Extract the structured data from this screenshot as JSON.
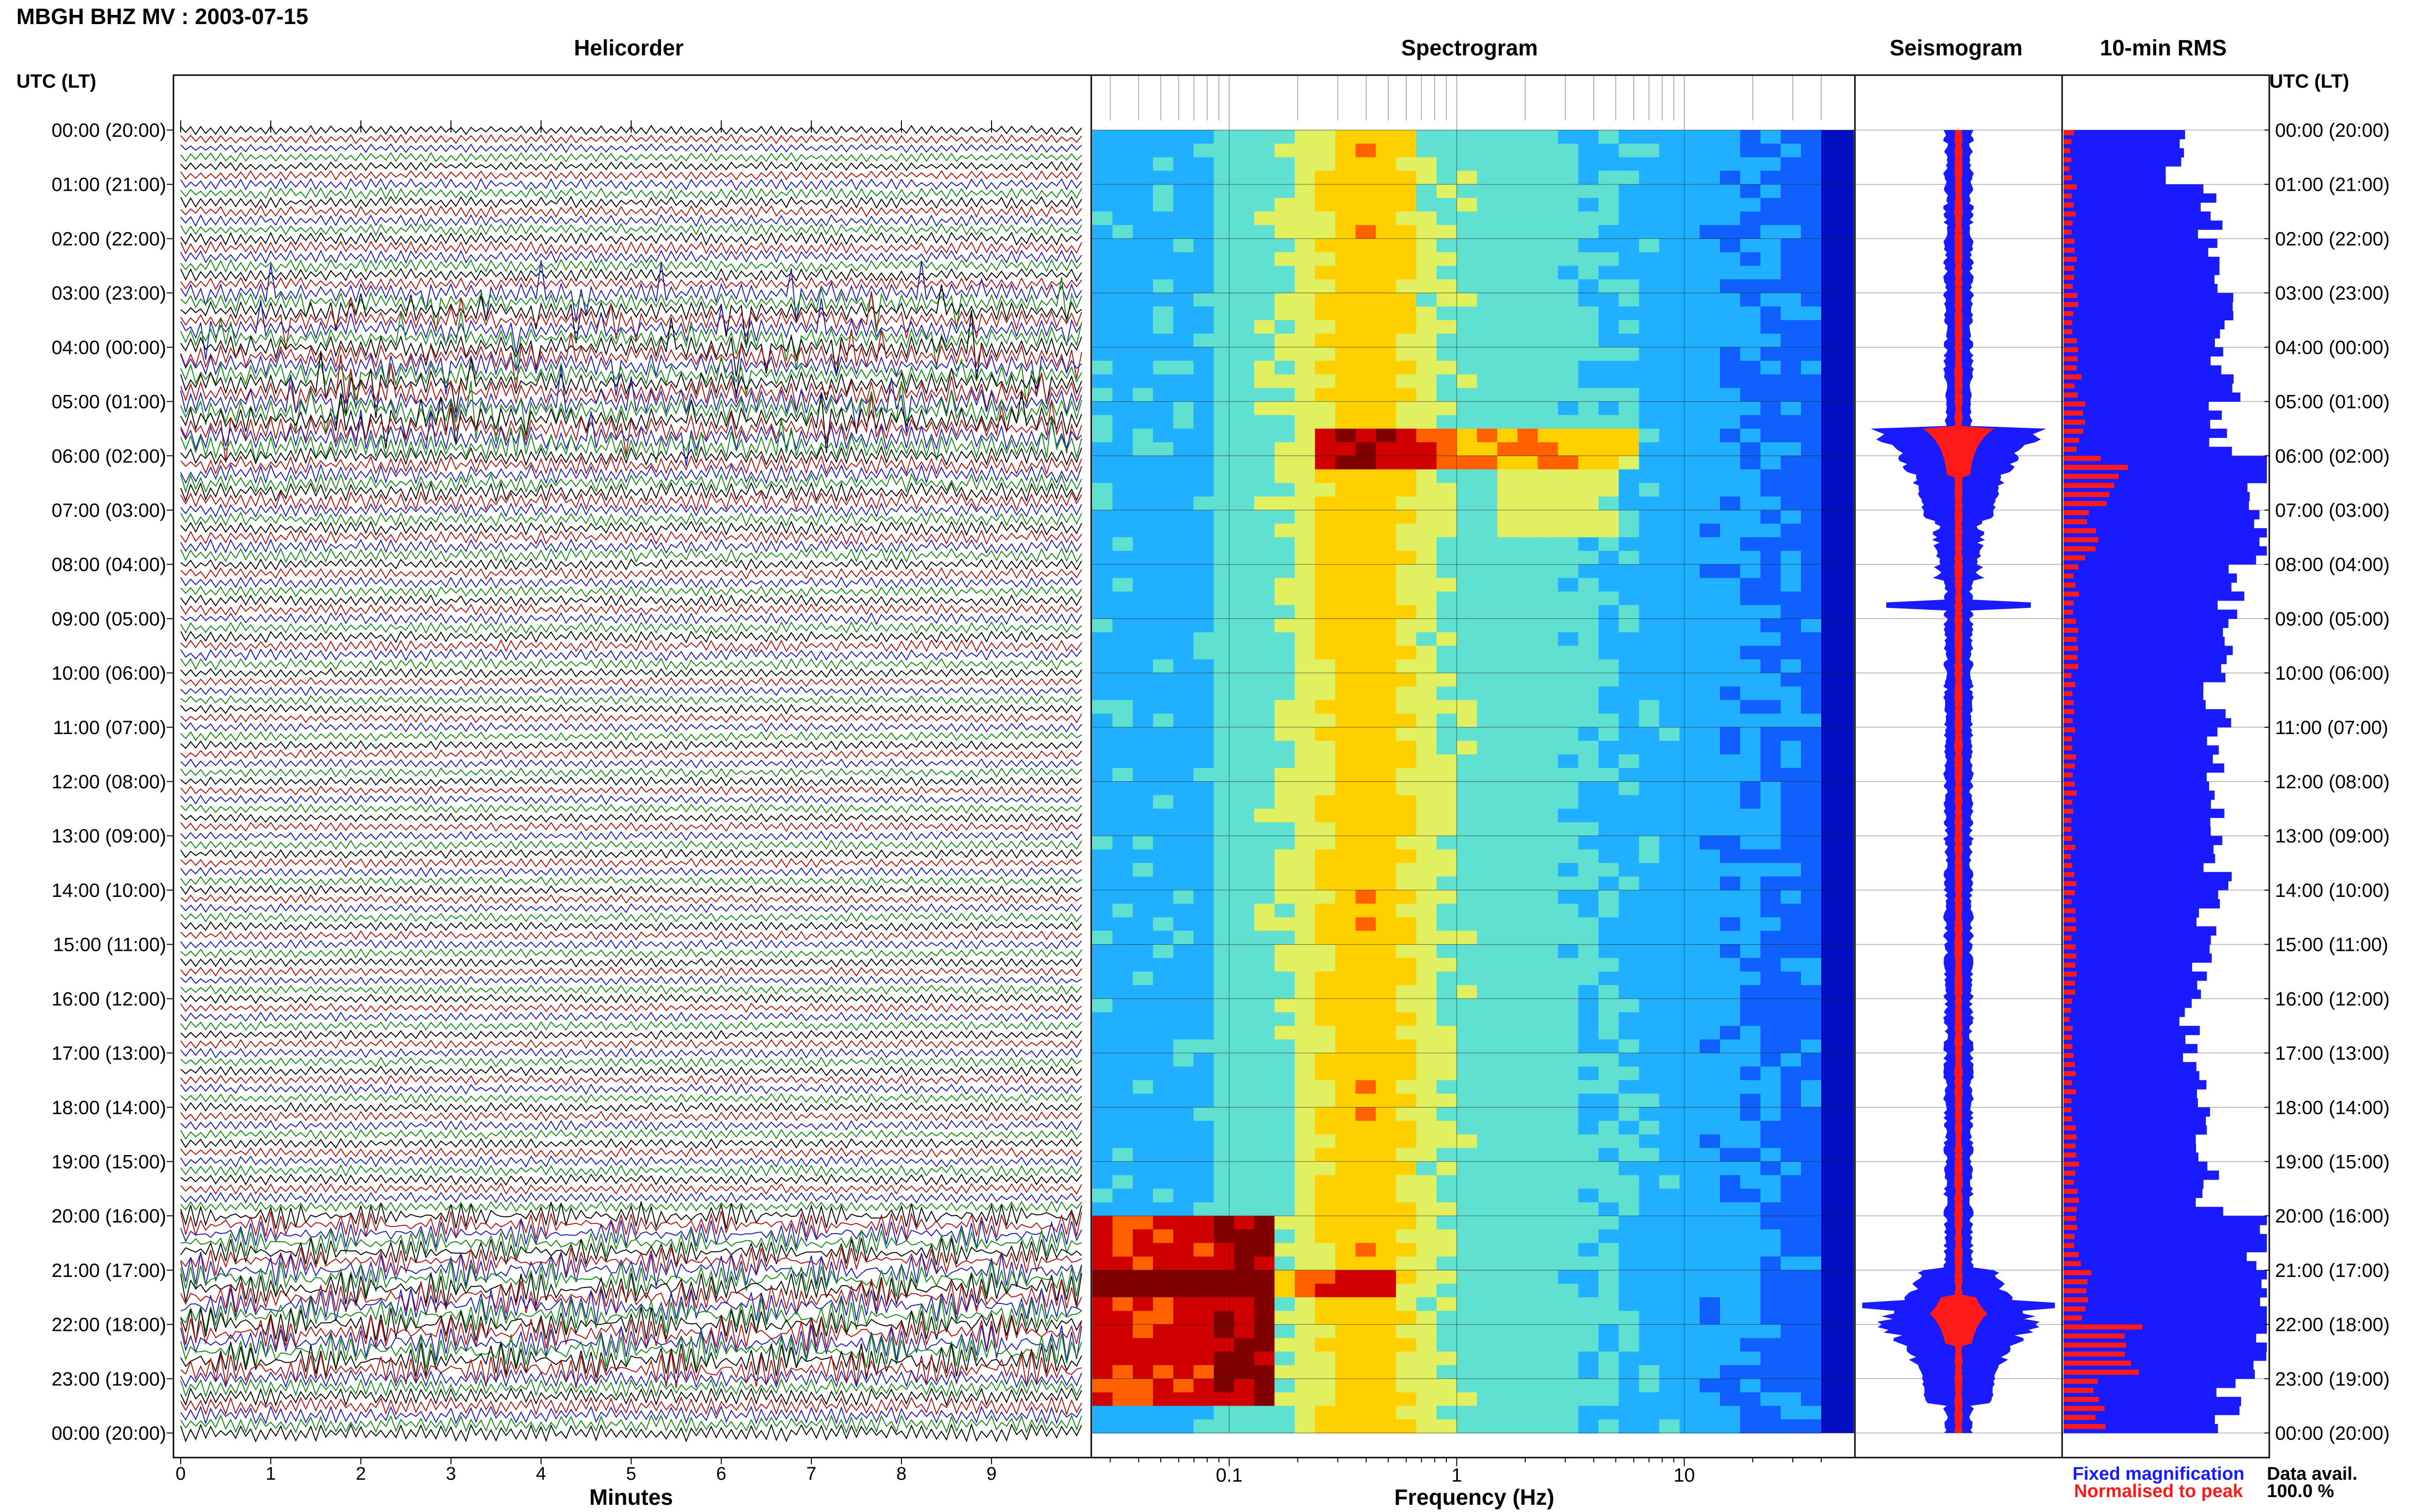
{
  "header": {
    "title": "MBGH BHZ MV : 2003-07-15",
    "utc_label_left": "UTC (LT)",
    "utc_label_right": "UTC (LT)"
  },
  "panels": {
    "helicorder": "Helicorder",
    "spectrogram": "Spectrogram",
    "seismogram": "Seismogram",
    "rms": "10-min RMS"
  },
  "time_labels": [
    "00:00 (20:00)",
    "01:00 (21:00)",
    "02:00 (22:00)",
    "03:00 (23:00)",
    "04:00 (00:00)",
    "05:00 (01:00)",
    "06:00 (02:00)",
    "07:00 (03:00)",
    "08:00 (04:00)",
    "09:00 (05:00)",
    "10:00 (06:00)",
    "11:00 (07:00)",
    "12:00 (08:00)",
    "13:00 (09:00)",
    "14:00 (10:00)",
    "15:00 (11:00)",
    "16:00 (12:00)",
    "17:00 (13:00)",
    "18:00 (14:00)",
    "19:00 (15:00)",
    "20:00 (16:00)",
    "21:00 (17:00)",
    "22:00 (18:00)",
    "23:00 (19:00)",
    "00:00 (20:00)"
  ],
  "legend": {
    "fixed": "Fixed magnification",
    "normalised": "Normalised to peak",
    "fixed_color": "#1a1aff",
    "normalised_color": "#ff1a1a"
  },
  "availability": {
    "label": "Data avail.",
    "value": "100.0 %"
  },
  "chart_data": [
    {
      "type": "line",
      "title": "Helicorder",
      "xlabel": "Minutes",
      "xlim": [
        0,
        10
      ],
      "x_ticks": [
        "0",
        "1",
        "2",
        "3",
        "4",
        "5",
        "6",
        "7",
        "8",
        "9"
      ],
      "trace_colors": [
        "#000000",
        "#b01010",
        "#1a1ab4",
        "#108a10"
      ],
      "rows_per_hour": 6,
      "activity_by_hour": [
        1.0,
        1.4,
        1.6,
        2.6,
        3.2,
        3.6,
        2.6,
        1.8,
        1.3,
        1.4,
        1.0,
        1.0,
        1.0,
        1.0,
        1.0,
        1.0,
        1.0,
        1.1,
        1.1,
        1.3,
        2.2,
        3.6,
        3.8,
        2.4
      ]
    },
    {
      "type": "heatmap",
      "title": "Spectrogram",
      "xlabel": "Frequency (Hz)",
      "x_scale": "log",
      "xlim": [
        0.025,
        40
      ],
      "x_ticks": [
        "0.1",
        "1",
        "10"
      ],
      "colormap": [
        "#0000a0",
        "#1060ff",
        "#20b0ff",
        "#60e0d0",
        "#e0f060",
        "#ffd000",
        "#ff6000",
        "#d00000",
        "#800000"
      ]
    },
    {
      "type": "area",
      "title": "Seismogram",
      "series": [
        {
          "name": "Fixed magnification",
          "color": "#1a1aff"
        },
        {
          "name": "Normalised to peak",
          "color": "#ff1a1a"
        }
      ]
    },
    {
      "type": "bar",
      "title": "10-min RMS",
      "categories": [
        "00:00",
        "01:00",
        "02:00",
        "03:00",
        "04:00",
        "05:00",
        "06:00",
        "07:00",
        "08:00",
        "09:00",
        "10:00",
        "11:00",
        "12:00",
        "13:00",
        "14:00",
        "15:00",
        "16:00",
        "17:00",
        "18:00",
        "19:00",
        "20:00",
        "21:00",
        "22:00",
        "23:00"
      ],
      "series": [
        {
          "name": "Fixed magnification",
          "color": "#1a1aff",
          "values": [
            0.55,
            0.72,
            0.73,
            0.78,
            0.8,
            0.78,
            1.0,
            1.0,
            0.82,
            0.78,
            0.75,
            0.78,
            0.75,
            0.76,
            0.72,
            0.7,
            0.62,
            0.65,
            0.7,
            0.72,
            1.0,
            1.0,
            1.0,
            0.8
          ]
        },
        {
          "name": "Normalised to peak",
          "color": "#ff1a1a",
          "values": [
            0.04,
            0.05,
            0.05,
            0.06,
            0.07,
            0.09,
            0.25,
            0.14,
            0.06,
            0.06,
            0.05,
            0.05,
            0.05,
            0.05,
            0.05,
            0.05,
            0.04,
            0.05,
            0.05,
            0.06,
            0.07,
            0.12,
            0.3,
            0.18
          ]
        }
      ]
    }
  ]
}
